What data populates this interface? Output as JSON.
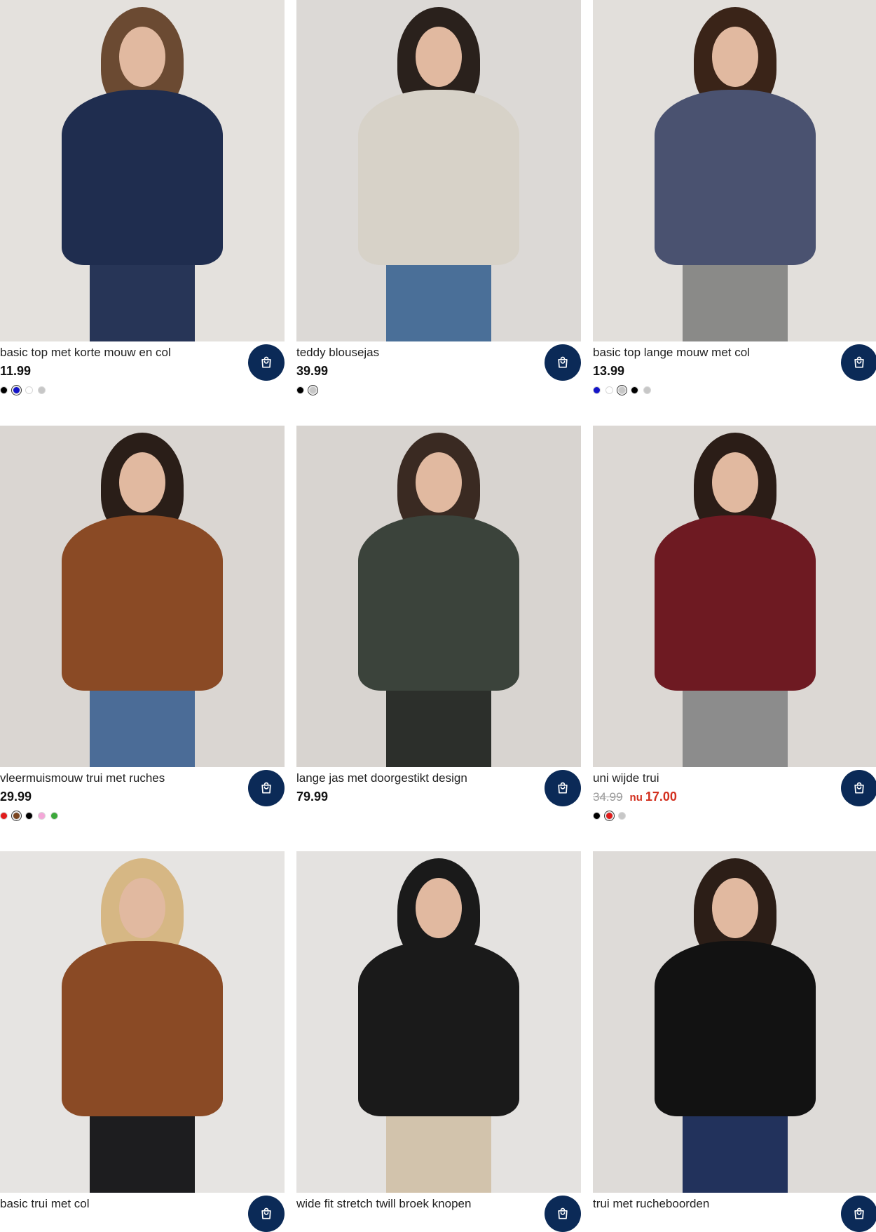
{
  "products": [
    {
      "title": "basic top met korte mouw en col",
      "price": "11.99",
      "swatches": [
        "#000000",
        "#1414c8",
        "#ffffff",
        "#c7c7c7"
      ],
      "selected": 1,
      "photo": {
        "bg": "#e4e1dd",
        "top": "#1f2d4f",
        "pants": "#273557",
        "hair": "#6b4a32"
      },
      "cart_label": "shopping-bag"
    },
    {
      "title": "teddy blousejas",
      "price": "39.99",
      "swatches": [
        "#000000",
        "#c7c7c7"
      ],
      "selected": 1,
      "photo": {
        "bg": "#dcd9d6",
        "top": "#d7d2c8",
        "pants": "#4a6f98",
        "hair": "#2a211c"
      },
      "cart_label": "shopping-bag"
    },
    {
      "title": "basic top lange mouw met col",
      "price": "13.99",
      "swatches": [
        "#1414c8",
        "#ffffff",
        "#c7c7c7",
        "#000000",
        "#c7c7c7"
      ],
      "selected": 2,
      "photo": {
        "bg": "#e2dfdb",
        "top": "#4a5270",
        "pants": "#8a8a88",
        "hair": "#3a2418"
      },
      "cart_label": "shopping-bag"
    },
    {
      "title": "vleermuismouw trui met ruches",
      "price": "29.99",
      "swatches": [
        "#e01b1b",
        "#7a4520",
        "#000000",
        "#f4a7d8",
        "#3ba83a"
      ],
      "selected": 1,
      "photo": {
        "bg": "#dad6d2",
        "top": "#8a4a25",
        "pants": "#4b6c97",
        "hair": "#2a1e18"
      },
      "cart_label": "shopping-bag"
    },
    {
      "title": "lange jas met doorgestikt design",
      "price": "79.99",
      "swatches": [],
      "selected": -1,
      "photo": {
        "bg": "#d8d4d0",
        "top": "#3b433b",
        "pants": "#2c2f2b",
        "hair": "#3a2a22"
      },
      "cart_label": "shopping-bag"
    },
    {
      "title": "uni wijde trui",
      "price_old": "34.99",
      "price_prefix": "nu",
      "price_new": "17.00",
      "swatches": [
        "#000000",
        "#e01b1b",
        "#c7c7c7"
      ],
      "selected": 1,
      "photo": {
        "bg": "#dcd8d4",
        "top": "#6e1a22",
        "pants": "#8c8c8c",
        "hair": "#2b1d17"
      },
      "cart_label": "shopping-bag"
    },
    {
      "title": "basic trui met col",
      "price": "",
      "swatches": [],
      "selected": -1,
      "photo": {
        "bg": "#e6e4e2",
        "top": "#8a4a25",
        "pants": "#1d1d1f",
        "hair": "#d6b784"
      },
      "cart_label": "shopping-bag"
    },
    {
      "title": "wide fit stretch twill broek knopen",
      "price": "",
      "swatches": [],
      "selected": -1,
      "photo": {
        "bg": "#e4e2e0",
        "top": "#1a1a1a",
        "pants": "#d2c3ac",
        "hair": "#1a1a1a"
      },
      "cart_label": "shopping-bag"
    },
    {
      "title": "trui met rucheboorden",
      "price": "",
      "swatches": [],
      "selected": -1,
      "photo": {
        "bg": "#dedbd8",
        "top": "#121212",
        "pants": "#22325c",
        "hair": "#2c1e17"
      },
      "cart_label": "shopping-bag"
    }
  ]
}
